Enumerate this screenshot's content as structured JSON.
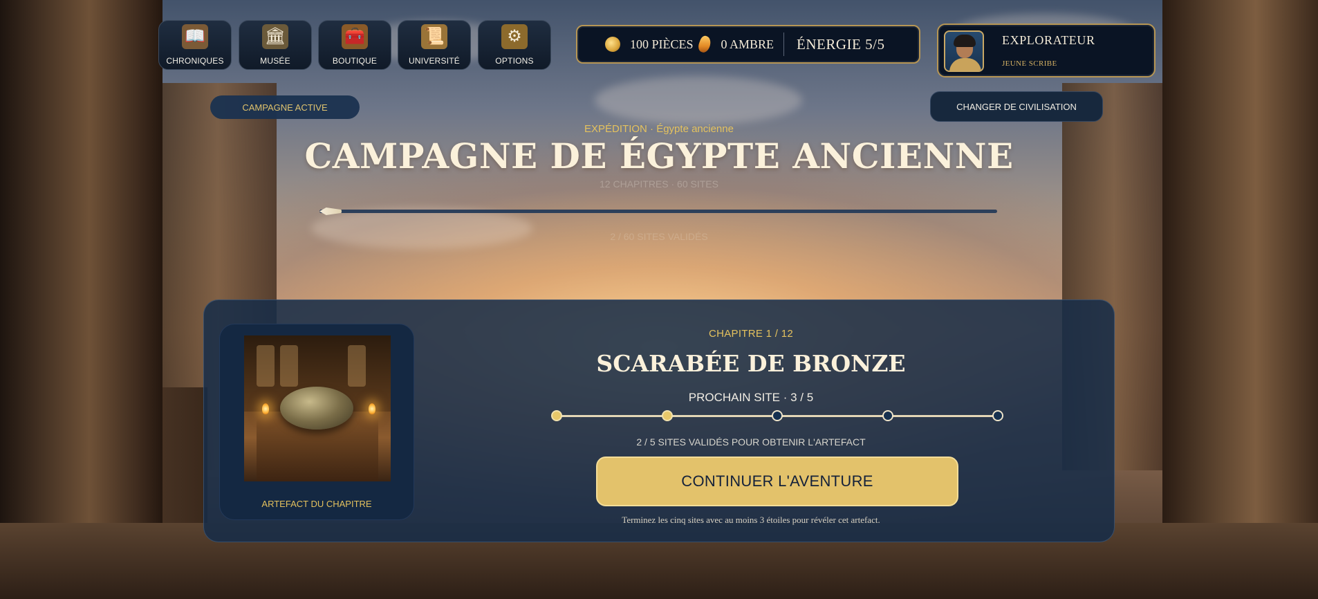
{
  "nav": [
    {
      "label": "CHRONIQUES",
      "icon": "chronicles-book-icon",
      "glyph": "📖",
      "color": "#7b5a36"
    },
    {
      "label": "MUSÉE",
      "icon": "museum-building-icon",
      "glyph": "🏛",
      "color": "#6b5a3a"
    },
    {
      "label": "BOUTIQUE",
      "icon": "treasure-chest-icon",
      "glyph": "🧰",
      "color": "#8a5a28"
    },
    {
      "label": "UNIVERSITÉ",
      "icon": "scroll-map-icon",
      "glyph": "📜",
      "color": "#9a7438"
    },
    {
      "label": "OPTIONS",
      "icon": "gear-icon",
      "glyph": "⚙",
      "color": "#8c6a2c"
    }
  ],
  "resources": {
    "coins": "100 PIÈCES",
    "amber": "0 AMBRE",
    "energy": "ÉNERGIE 5/5",
    "coin_icon": "gold-coin-icon",
    "amber_icon": "amber-gem-icon"
  },
  "profile": {
    "name": "EXPLORATEUR",
    "rank": "JEUNE SCRIBE",
    "avatar_icon": "explorer-avatar"
  },
  "campaign_pill": "CAMPAGNE ACTIVE",
  "change_civ_label": "CHANGER DE CIVILISATION",
  "hero": {
    "expedition": "EXPÉDITION · Égypte ancienne",
    "title": "CAMPAGNE DE ÉGYPTE ANCIENNE",
    "subtitle": "12 CHAPITRES · 60 SITES",
    "sites_progress": "2 / 60 SITES VALIDÉS",
    "campaign_progress": 0.033
  },
  "chapter": {
    "index": "CHAPITRE 1 / 12",
    "title": "SCARABÉE DE BRONZE",
    "next_site": "PROCHAIN SITE · 3 / 5",
    "sites_total": 5,
    "sites_done": 2,
    "validated": "2 / 5 SITES VALIDÉS POUR OBTENIR L'ARTEFACT",
    "continue_label": "CONTINUER L'AVENTURE",
    "hint": "Terminez les cinq sites avec au moins 3 étoiles pour révéler cet artefact.",
    "artifact_label": "ARTEFACT DU CHAPITRE"
  },
  "colors": {
    "gold": "#e5c25e",
    "panel": "#162c48",
    "button": "#e3c26b",
    "frame": "#b79654"
  }
}
